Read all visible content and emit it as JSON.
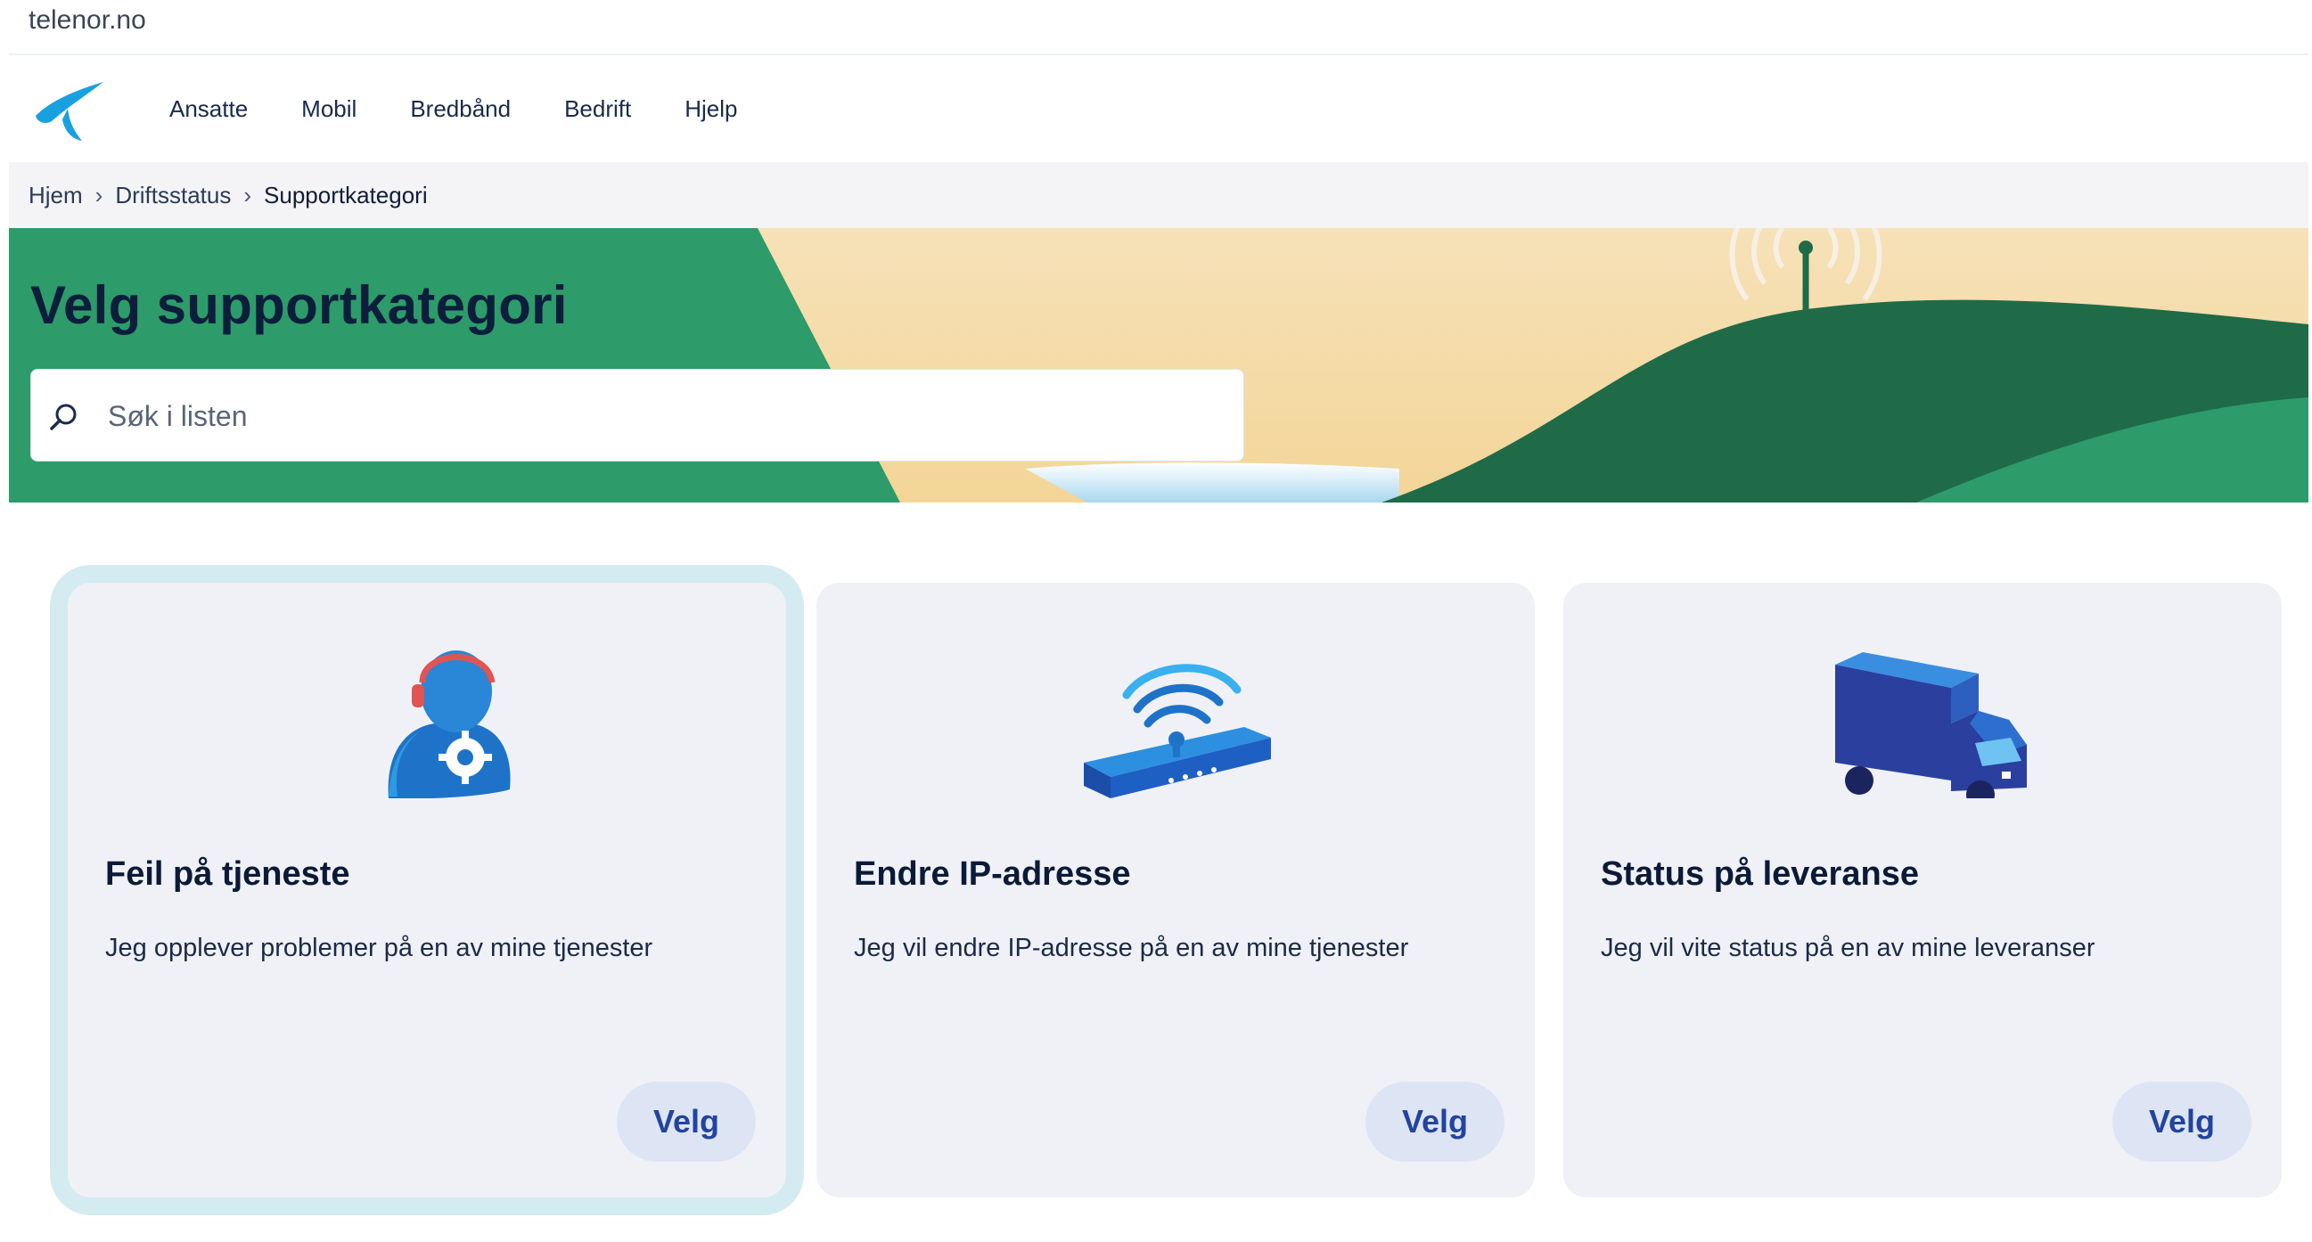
{
  "url": "telenor.no",
  "nav": {
    "items": [
      "Ansatte",
      "Mobil",
      "Bredbånd",
      "Bedrift",
      "Hjelp"
    ]
  },
  "breadcrumb": {
    "items": [
      "Hjem",
      "Driftsstatus",
      "Supportkategori"
    ]
  },
  "hero": {
    "title": "Velg supportkategori"
  },
  "search": {
    "placeholder": "Søk i listen",
    "value": ""
  },
  "cards": [
    {
      "title": "Feil på tjeneste",
      "description": "Jeg opplever problemer på en av mine tjenester",
      "button": "Velg",
      "icon": "support-agent-icon",
      "selected": true
    },
    {
      "title": "Endre IP-adresse",
      "description": "Jeg vil endre IP-adresse på en av mine tjenester",
      "button": "Velg",
      "icon": "router-wifi-icon",
      "selected": false
    },
    {
      "title": "Status på leveranse",
      "description": "Jeg vil vite status på en av mine leveranser",
      "button": "Velg",
      "icon": "delivery-truck-icon",
      "selected": false
    }
  ],
  "colors": {
    "brand_blue": "#19a0e0",
    "hero_green": "#2d9b6a",
    "hero_dark_green": "#1f6b48",
    "button_text": "#23439e",
    "selected_ring": "#d4ecf1"
  }
}
